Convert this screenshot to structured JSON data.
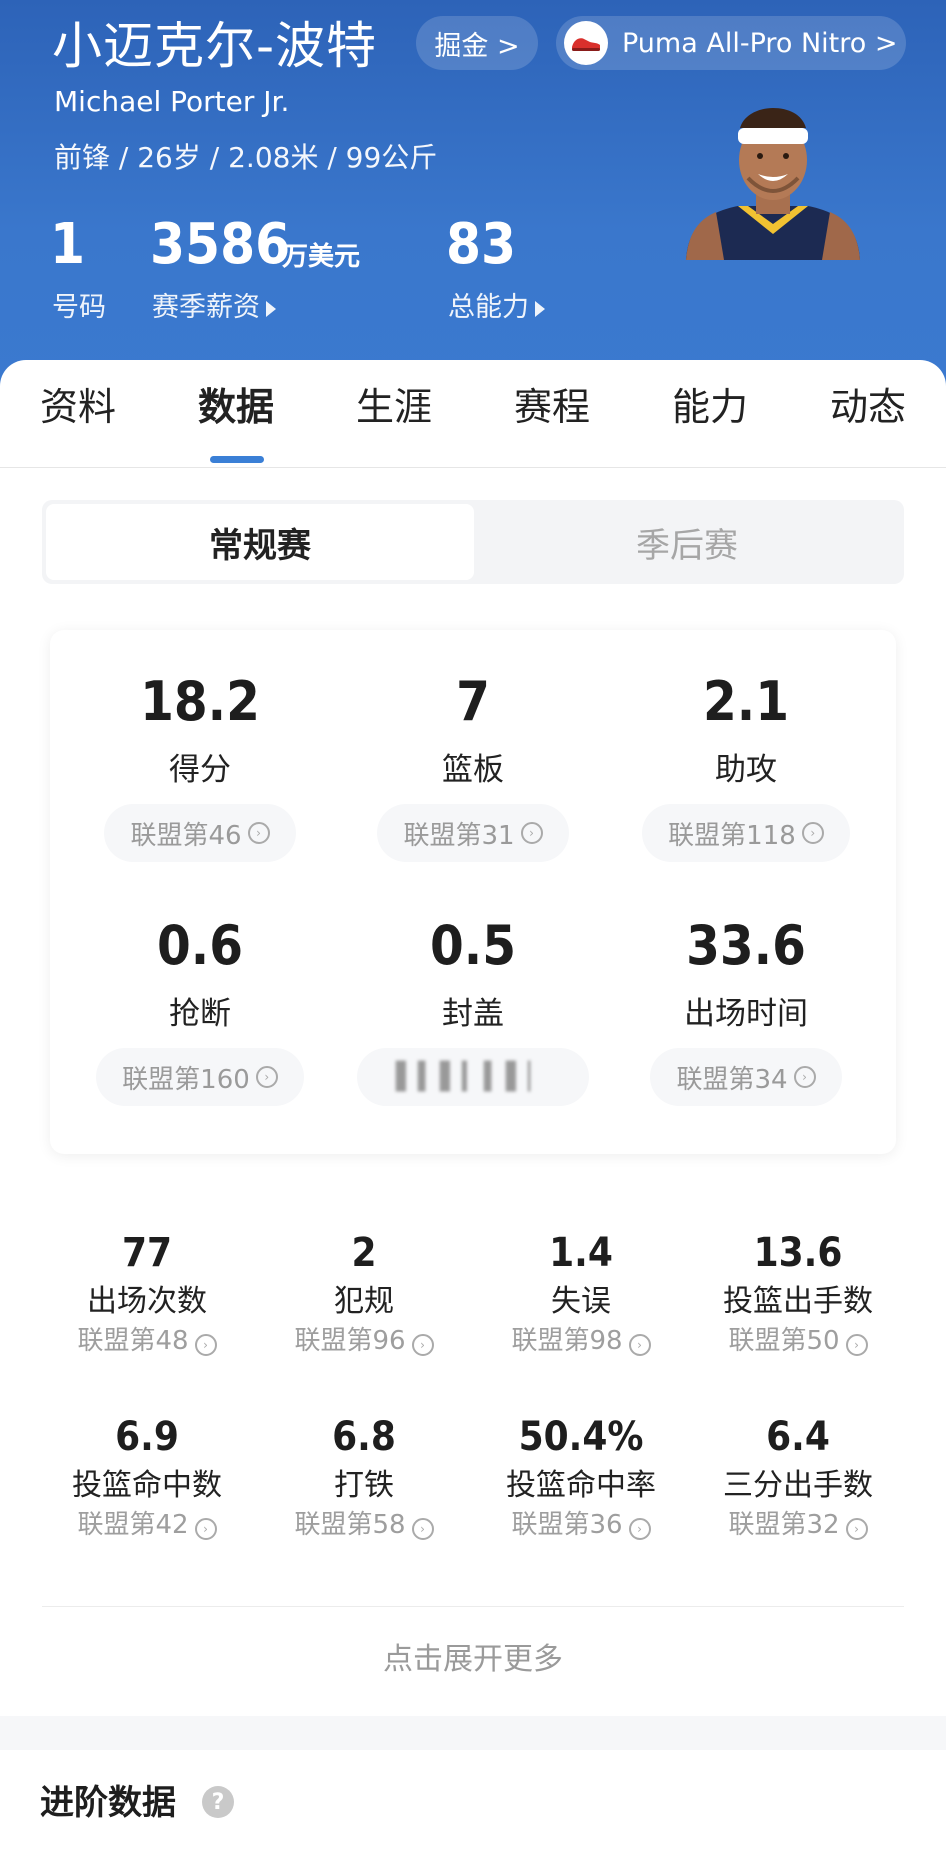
{
  "player": {
    "name_zh": "小迈克尔-波特",
    "name_en": "Michael Porter Jr.",
    "bio": "前锋 / 26岁 / 2.08米 / 99公斤",
    "gold_label": "掘金 >",
    "shoe_label": "Puma All-Pro Nitro >",
    "number": "1",
    "number_label": "号码",
    "salary": "3586",
    "salary_unit": "万美元",
    "salary_label": "赛季薪资",
    "rating": "83",
    "rating_label": "总能力"
  },
  "tabs": [
    {
      "label": "资料"
    },
    {
      "label": "数据"
    },
    {
      "label": "生涯"
    },
    {
      "label": "赛程"
    },
    {
      "label": "能力"
    },
    {
      "label": "动态"
    }
  ],
  "segment": {
    "regular": "常规赛",
    "playoffs": "季后赛"
  },
  "main_stats": [
    {
      "value": "18.2",
      "label": "得分",
      "rank": "联盟第46"
    },
    {
      "value": "7",
      "label": "篮板",
      "rank": "联盟第31"
    },
    {
      "value": "2.1",
      "label": "助攻",
      "rank": "联盟第118"
    },
    {
      "value": "0.6",
      "label": "抢断",
      "rank": "联盟第160"
    },
    {
      "value": "0.5",
      "label": "封盖",
      "rank": "▌▍▌▎▍▌▏"
    },
    {
      "value": "33.6",
      "label": "出场时间",
      "rank": "联盟第34"
    }
  ],
  "small_stats": [
    {
      "value": "77",
      "label": "出场次数",
      "rank": "联盟第48"
    },
    {
      "value": "2",
      "label": "犯规",
      "rank": "联盟第96"
    },
    {
      "value": "1.4",
      "label": "失误",
      "rank": "联盟第98"
    },
    {
      "value": "13.6",
      "label": "投篮出手数",
      "rank": "联盟第50"
    },
    {
      "value": "6.9",
      "label": "投篮命中数",
      "rank": "联盟第42"
    },
    {
      "value": "6.8",
      "label": "打铁",
      "rank": "联盟第58"
    },
    {
      "value": "50.4%",
      "label": "投篮命中率",
      "rank": "联盟第36"
    },
    {
      "value": "6.4",
      "label": "三分出手数",
      "rank": "联盟第32"
    }
  ],
  "expand_label": "点击展开更多",
  "advanced_title": "进阶数据",
  "help_glyph": "?",
  "info_glyph": "›",
  "colors": {
    "header_blue": "#3a77cc",
    "accent_blue": "#3a7fd6",
    "muted_gray": "#9a9a9a"
  },
  "icons": [
    "shoe-icon",
    "player-avatar",
    "info-icon",
    "help-icon",
    "caret-right-icon"
  ]
}
